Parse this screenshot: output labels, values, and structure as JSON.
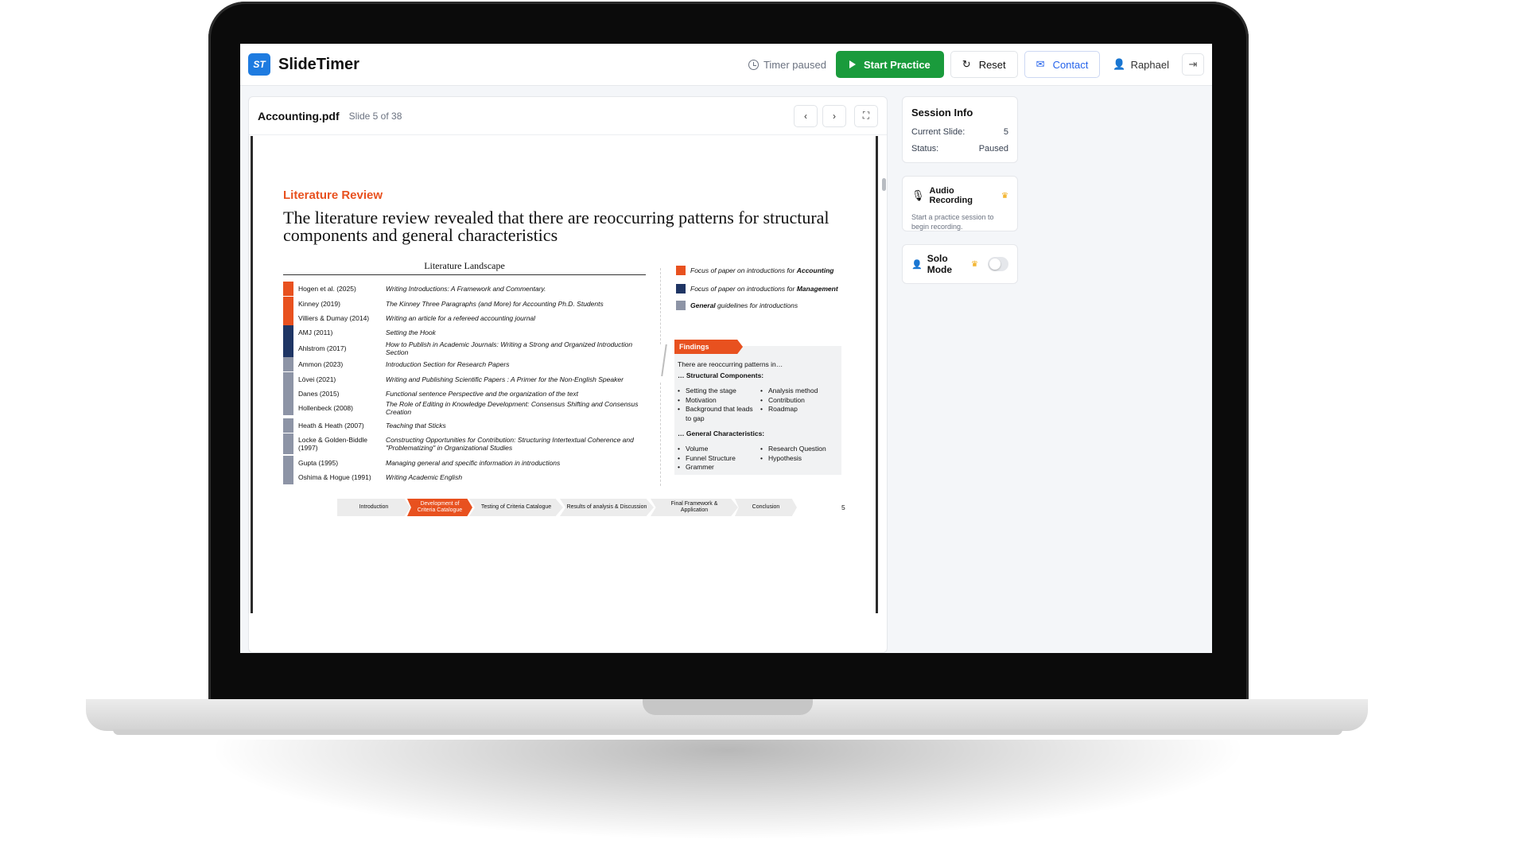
{
  "app": {
    "logo": "ST",
    "title": "SlideTimer"
  },
  "header": {
    "timer_status": "Timer paused",
    "start_label": "Start Practice",
    "reset_label": "Reset",
    "contact_label": "Contact",
    "user_name": "Raphael"
  },
  "viewer": {
    "file_name": "Accounting.pdf",
    "slide_count": "Slide 5 of 38"
  },
  "slide": {
    "section": "Literature Review",
    "headline": "The literature review revealed that there are reoccurring patterns for structural components and general characteristics",
    "landscape_title": "Literature Landscape",
    "rows": [
      {
        "author": "Hogen et al. (2025)",
        "title": "Writing Introductions: A Framework and Commentary.",
        "category": "accounting"
      },
      {
        "author": "Kinney (2019)",
        "title": "The Kinney Three Paragraphs (and More) for Accounting Ph.D. Students",
        "category": "accounting"
      },
      {
        "author": "Villiers & Dumay (2014)",
        "title": "Writing an article for a refereed accounting journal",
        "category": "accounting"
      },
      {
        "author": "AMJ (2011)",
        "title": "Setting the Hook",
        "category": "management"
      },
      {
        "author": "Ahlstrom (2017)",
        "title": "How to Publish in Academic Journals: Writing a Strong and Organized Introduction Section",
        "category": "management"
      },
      {
        "author": "Ammon (2023)",
        "title": "Introduction Section for Research Papers",
        "category": "general"
      },
      {
        "author": "Lövei (2021)",
        "title": "Writing and Publishing Scientific Papers : A Primer for the Non-English Speaker",
        "category": "general"
      },
      {
        "author": "Danes (2015)",
        "title": "Functional sentence Perspective and the organization of the text",
        "category": "general"
      },
      {
        "author": "Hollenbeck (2008)",
        "title": "The Role of Editing in Knowledge Development: Consensus Shifting and Consensus Creation",
        "category": "general"
      },
      {
        "author": "Heath & Heath (2007)",
        "title": "Teaching that Sticks",
        "category": "general"
      },
      {
        "author": "Locke & Golden-Biddle (1997)",
        "title": "Constructing Opportunities for Contribution: Structuring Intertextual Coherence and \"Problematizing\" in Organizational Studies",
        "category": "general"
      },
      {
        "author": "Gupta (1995)",
        "title": "Managing general and specific information in introductions",
        "category": "general"
      },
      {
        "author": "Oshima & Hogue (1991)",
        "title": "Writing Academic English",
        "category": "general"
      }
    ],
    "legend": [
      {
        "prefix": "Focus of paper on introductions for ",
        "bold": "Accounting",
        "color": "#e8511f"
      },
      {
        "prefix": "Focus of paper on introductions for ",
        "bold": "Management",
        "color": "#1f3564"
      },
      {
        "prefix": "",
        "bold": "General",
        "suffix": " guidelines for introductions",
        "color": "#8d94a6"
      }
    ],
    "findings": {
      "tag": "Findings",
      "intro": "There are reoccurring patterns in…",
      "structural_heading": "… Structural Components:",
      "structural_left": [
        "Setting the stage",
        "Motivation",
        "Background that leads to gap"
      ],
      "structural_right": [
        "Analysis method",
        "Contribution",
        "Roadmap"
      ],
      "general_heading": "… General Characteristics:",
      "general_left": [
        "Volume",
        "Funnel Structure",
        "Grammer"
      ],
      "general_right": [
        "Research Question",
        "Hypothesis"
      ]
    },
    "progress_steps": [
      "Introduction",
      "Development of Criteria Catalogue",
      "Testing of Criteria Catalogue",
      "Results of analysis & Discussion",
      "Final Framework & Application",
      "Conclusion"
    ],
    "active_step": 1,
    "page_number": "5"
  },
  "sidebar": {
    "session": {
      "title": "Session Info",
      "current_label": "Current Slide:",
      "current_value": "5",
      "status_label": "Status:",
      "status_value": "Paused"
    },
    "audio": {
      "title": "Audio Recording",
      "note": "Start a practice session to begin recording."
    },
    "solo": {
      "title": "Solo Mode",
      "enabled": false
    }
  },
  "colors": {
    "accent": "#e8511f",
    "management": "#1f3564",
    "general": "#8d94a6",
    "start_button": "#1a9b3c",
    "link": "#2563eb"
  },
  "icons": [
    "clock-icon",
    "play-icon",
    "reset-icon",
    "mail-icon",
    "user-icon",
    "logout-icon",
    "chevron-left-icon",
    "chevron-right-icon",
    "fullscreen-icon",
    "mic-icon",
    "crown-icon"
  ]
}
